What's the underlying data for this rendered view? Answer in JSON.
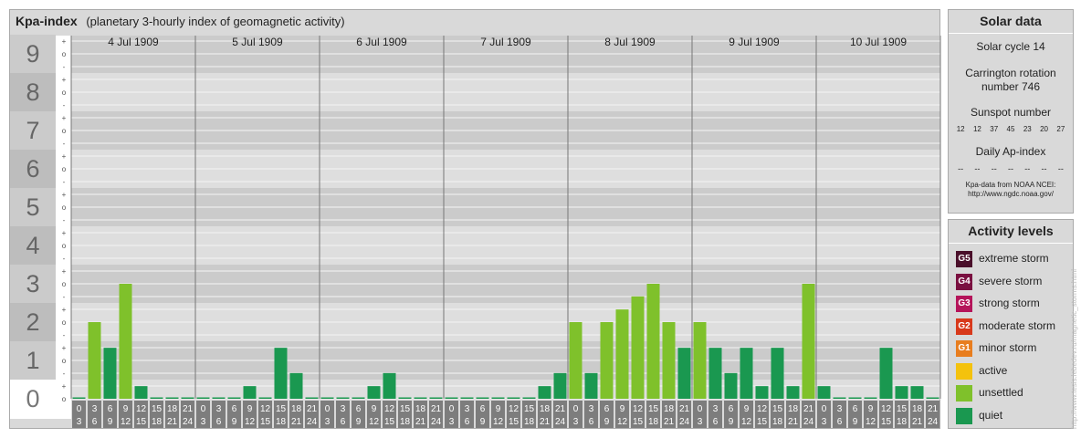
{
  "title": {
    "main": "Kpa-index",
    "subtitle": "(planetary 3-hourly index of geomagnetic activity)"
  },
  "chart_data": {
    "type": "bar",
    "y_major_ticks": [
      "0",
      "1",
      "2",
      "3",
      "4",
      "5",
      "6",
      "7",
      "8",
      "9"
    ],
    "y_minor_ticks": [
      "o",
      "+",
      "-",
      "o"
    ],
    "ylim": [
      0,
      9.33
    ],
    "days": [
      "4 Jul 1909",
      "5 Jul 1909",
      "6 Jul 1909",
      "7 Jul 1909",
      "8 Jul 1909",
      "9 Jul 1909",
      "10 Jul 1909"
    ],
    "interval_start_hours": [
      "0",
      "3",
      "6",
      "9",
      "12",
      "15",
      "18",
      "21"
    ],
    "interval_end_hours": [
      "3",
      "6",
      "9",
      "12",
      "15",
      "18",
      "21",
      "24"
    ],
    "values": [
      [
        0,
        2,
        1.33,
        3,
        0.33,
        0,
        0,
        0
      ],
      [
        0,
        0,
        0,
        0.33,
        0,
        1.33,
        0.67,
        0
      ],
      [
        0,
        0,
        0,
        0.33,
        0.67,
        0,
        0,
        0
      ],
      [
        0,
        0,
        0,
        0,
        0,
        0,
        0.33,
        0.67
      ],
      [
        2,
        0.67,
        2,
        2.33,
        2.67,
        3,
        2,
        1.33
      ],
      [
        2,
        1.33,
        0.67,
        1.33,
        0.33,
        1.33,
        0.33,
        3
      ],
      [
        0.33,
        0,
        0,
        0,
        1.33,
        0.33,
        0.33,
        0
      ]
    ],
    "level_colors": {
      "quiet": "#1a9850",
      "unsettled": "#7fc12b"
    },
    "unsettled_threshold": 1.67
  },
  "solar": {
    "title": "Solar data",
    "cycle": "Solar cycle 14",
    "carrington_line1": "Carrington rotation",
    "carrington_line2": "number 746",
    "sunspot_label": "Sunspot number",
    "sunspot_numbers": [
      "12",
      "12",
      "37",
      "45",
      "23",
      "20",
      "27"
    ],
    "ap_label": "Daily Ap-index",
    "ap_values": [
      "--",
      "--",
      "--",
      "--",
      "--",
      "--",
      "--"
    ],
    "source_line1": "Kpa-data from NOAA NCEI:",
    "source_line2": "http://www.ngdc.noaa.gov/"
  },
  "activity": {
    "title": "Activity levels",
    "levels": [
      {
        "code": "G5",
        "label": "extreme storm",
        "color": "#4a0f2a"
      },
      {
        "code": "G4",
        "label": "severe storm",
        "color": "#7a1040"
      },
      {
        "code": "G3",
        "label": "strong storm",
        "color": "#b5145a"
      },
      {
        "code": "G2",
        "label": "moderate storm",
        "color": "#d8391b"
      },
      {
        "code": "G1",
        "label": "minor storm",
        "color": "#e87d1e"
      },
      {
        "code": "",
        "label": "active",
        "color": "#f4c20d"
      },
      {
        "code": "",
        "label": "unsettled",
        "color": "#7fc12b"
      },
      {
        "code": "",
        "label": "quiet",
        "color": "#1a9850"
      }
    ]
  },
  "watermark": "http://www.tesis.lebedev.ru/magnetic_storms.html"
}
